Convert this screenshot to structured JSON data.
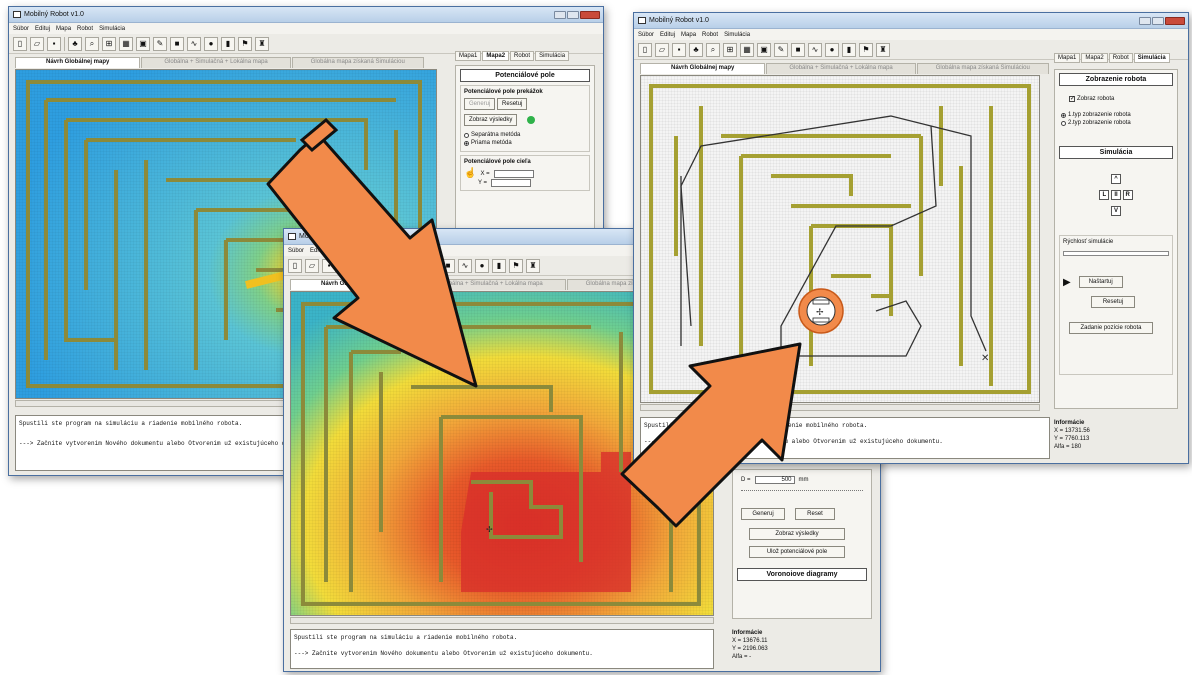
{
  "app_title": "Mobilný Robot v1.0",
  "menu": [
    "Súbor",
    "Edituj",
    "Mapa",
    "Robot",
    "Simulácia"
  ],
  "map_tabs": [
    "Návrh Globálnej mapy",
    "Globálna + Simulačná + Lokálna mapa",
    "Globálna mapa získaná Simuláciou"
  ],
  "right_tabs": [
    "Mapa1",
    "Mapa2",
    "Robot",
    "Simulácia"
  ],
  "console": {
    "line1": "Spustili ste program na simuláciu a riadenie mobilného robota.",
    "line2": "---> Začnite vytvorenim Nového dokumentu alebo Otvorenim už existujúceho dokumentu."
  },
  "panel_potential": {
    "title": "Potenciálové pole",
    "group1_title": "Potenciálové pole prekážok",
    "generate": "Generuj",
    "reset": "Resetuj",
    "show_results": "Zobraz výsledky",
    "method1": "Separátna metóda",
    "method2": "Priama metóda",
    "group2_title": "Potenciálové pole cieľa",
    "x_label": "X =",
    "y_label": "Y ="
  },
  "panel_middle": {
    "d_label": "D =",
    "d_value": "500",
    "d_unit": "mm",
    "generate": "Generuj",
    "reset": "Reset",
    "show_results": "Zobraz výsledky",
    "save": "Ulož potenciálové pole",
    "voronoi": "Voronoiove diagramy",
    "info_title": "Informácie",
    "x": "X = 13676.11",
    "y": "Y = 2196.063",
    "alfa": "Alfa = -"
  },
  "panel_robot": {
    "title": "Zobrazenie robota",
    "show_robot": "Zobraz robota",
    "type1": "1.typ zobrazenie robota",
    "type2": "2.typ zobrazenie robota",
    "sim_title": "Simulácia",
    "nav_up": "^",
    "nav_left": "L",
    "nav_mid": "II",
    "nav_right": "R",
    "nav_down": "V",
    "speed_label": "Rýchlosť simulácie",
    "start": "Naštartuj",
    "reset": "Resetuj",
    "set_pos": "Zadanie pozície robota",
    "info_title": "Informácie",
    "x": "X = 13731.56",
    "y": "Y = 7760.113",
    "alfa": "Alfa = 180"
  },
  "colors": {
    "arrow": "#f28a4a",
    "wall": "#8c8a3a",
    "field_far": "#2aa8e0",
    "field_near": "#e8342a"
  }
}
